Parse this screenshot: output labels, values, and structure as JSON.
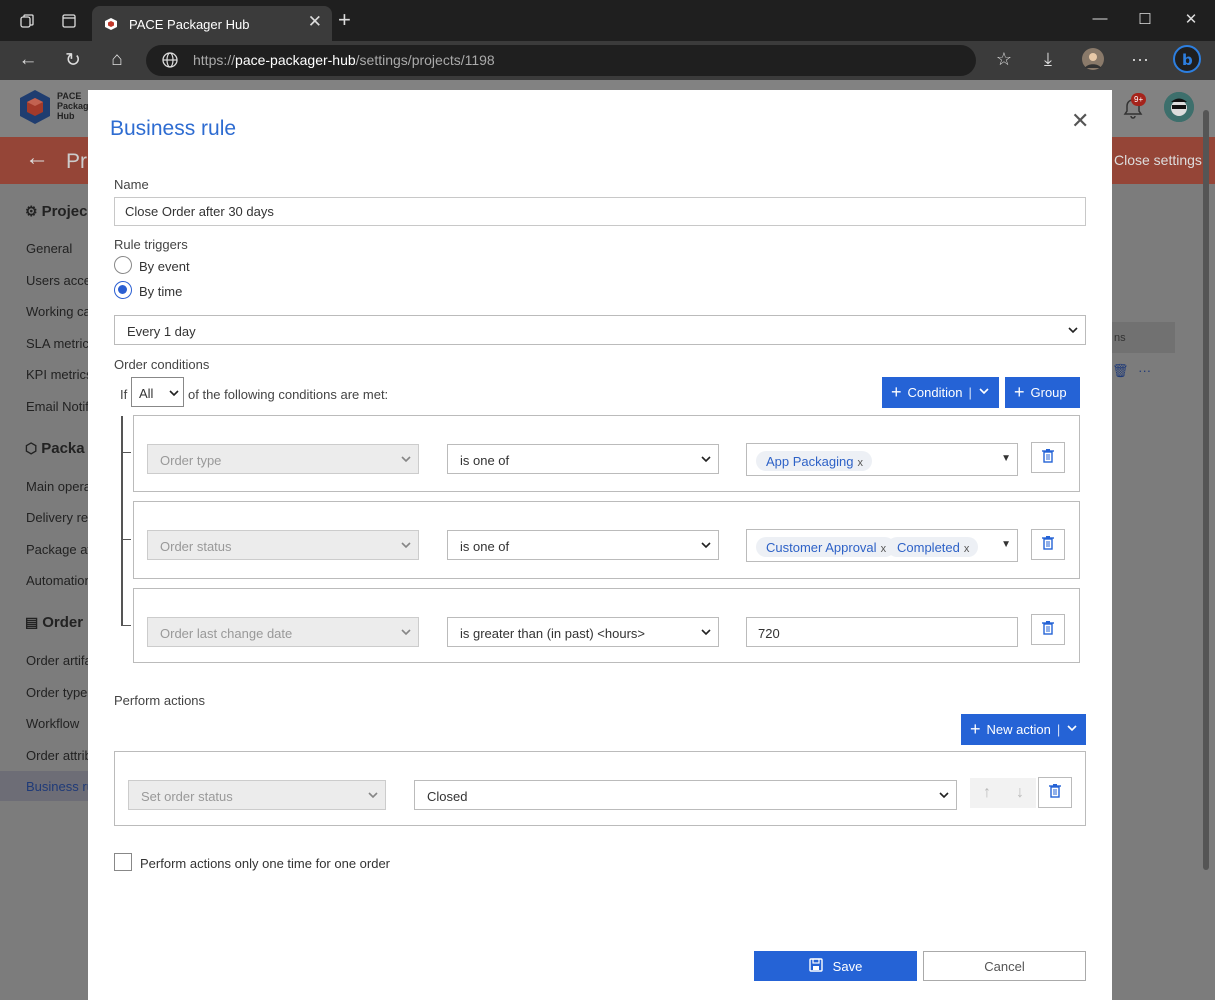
{
  "browser": {
    "tab_title": "PACE Packager Hub",
    "url_prefix": "https://",
    "url_host": "pace-packager-hub",
    "url_path": "/settings/projects/1198",
    "profile_icon": "user-avatar-icon"
  },
  "app": {
    "logo_line1": "PACE",
    "logo_line2": "Packag",
    "logo_line3": "Hub",
    "notification_badge": "9+",
    "page_title_fragment": "Pr",
    "close_settings": "Close settings",
    "table_col_fragment": "ns"
  },
  "sidebar": {
    "section1": "Projec",
    "section1_items": [
      "General",
      "Users acces",
      "Working ca",
      "SLA metric",
      "KPI metrics",
      "Email Notif"
    ],
    "section2": "Packa",
    "section2_items": [
      "Main opera",
      "Delivery re",
      "Package at",
      "Automation"
    ],
    "section3": "Order",
    "section3_items": [
      "Order artifa",
      "Order type",
      "Workflow",
      "Order attrib",
      "Business ru"
    ]
  },
  "modal": {
    "title": "Business rule",
    "name_label": "Name",
    "name_value": "Close Order after 30 days",
    "triggers_label": "Rule triggers",
    "trigger_event": "By event",
    "trigger_time": "By time",
    "schedule": "Every 1 day",
    "conditions_label": "Order conditions",
    "if_text": "If",
    "match_mode": "All",
    "following_text": "of the following conditions are met:",
    "condition_button": "Condition",
    "group_button": "Group",
    "conditions": [
      {
        "field": "Order type",
        "operator": "is one of",
        "tags": [
          "App Packaging"
        ]
      },
      {
        "field": "Order status",
        "operator": "is one of",
        "tags": [
          "Customer Approval",
          "Completed"
        ]
      },
      {
        "field": "Order last change date",
        "operator": "is greater than (in past) <hours>",
        "value": "720"
      }
    ],
    "tag_remove": "x",
    "actions_label": "Perform actions",
    "new_action_button": "New action",
    "action_field": "Set order status",
    "action_value": "Closed",
    "once_label": "Perform actions only one time for one order",
    "save": "Save",
    "cancel": "Cancel"
  },
  "colors": {
    "accent": "#2563d6",
    "title_blue": "#2e6cd1",
    "header_red": "#954537"
  }
}
